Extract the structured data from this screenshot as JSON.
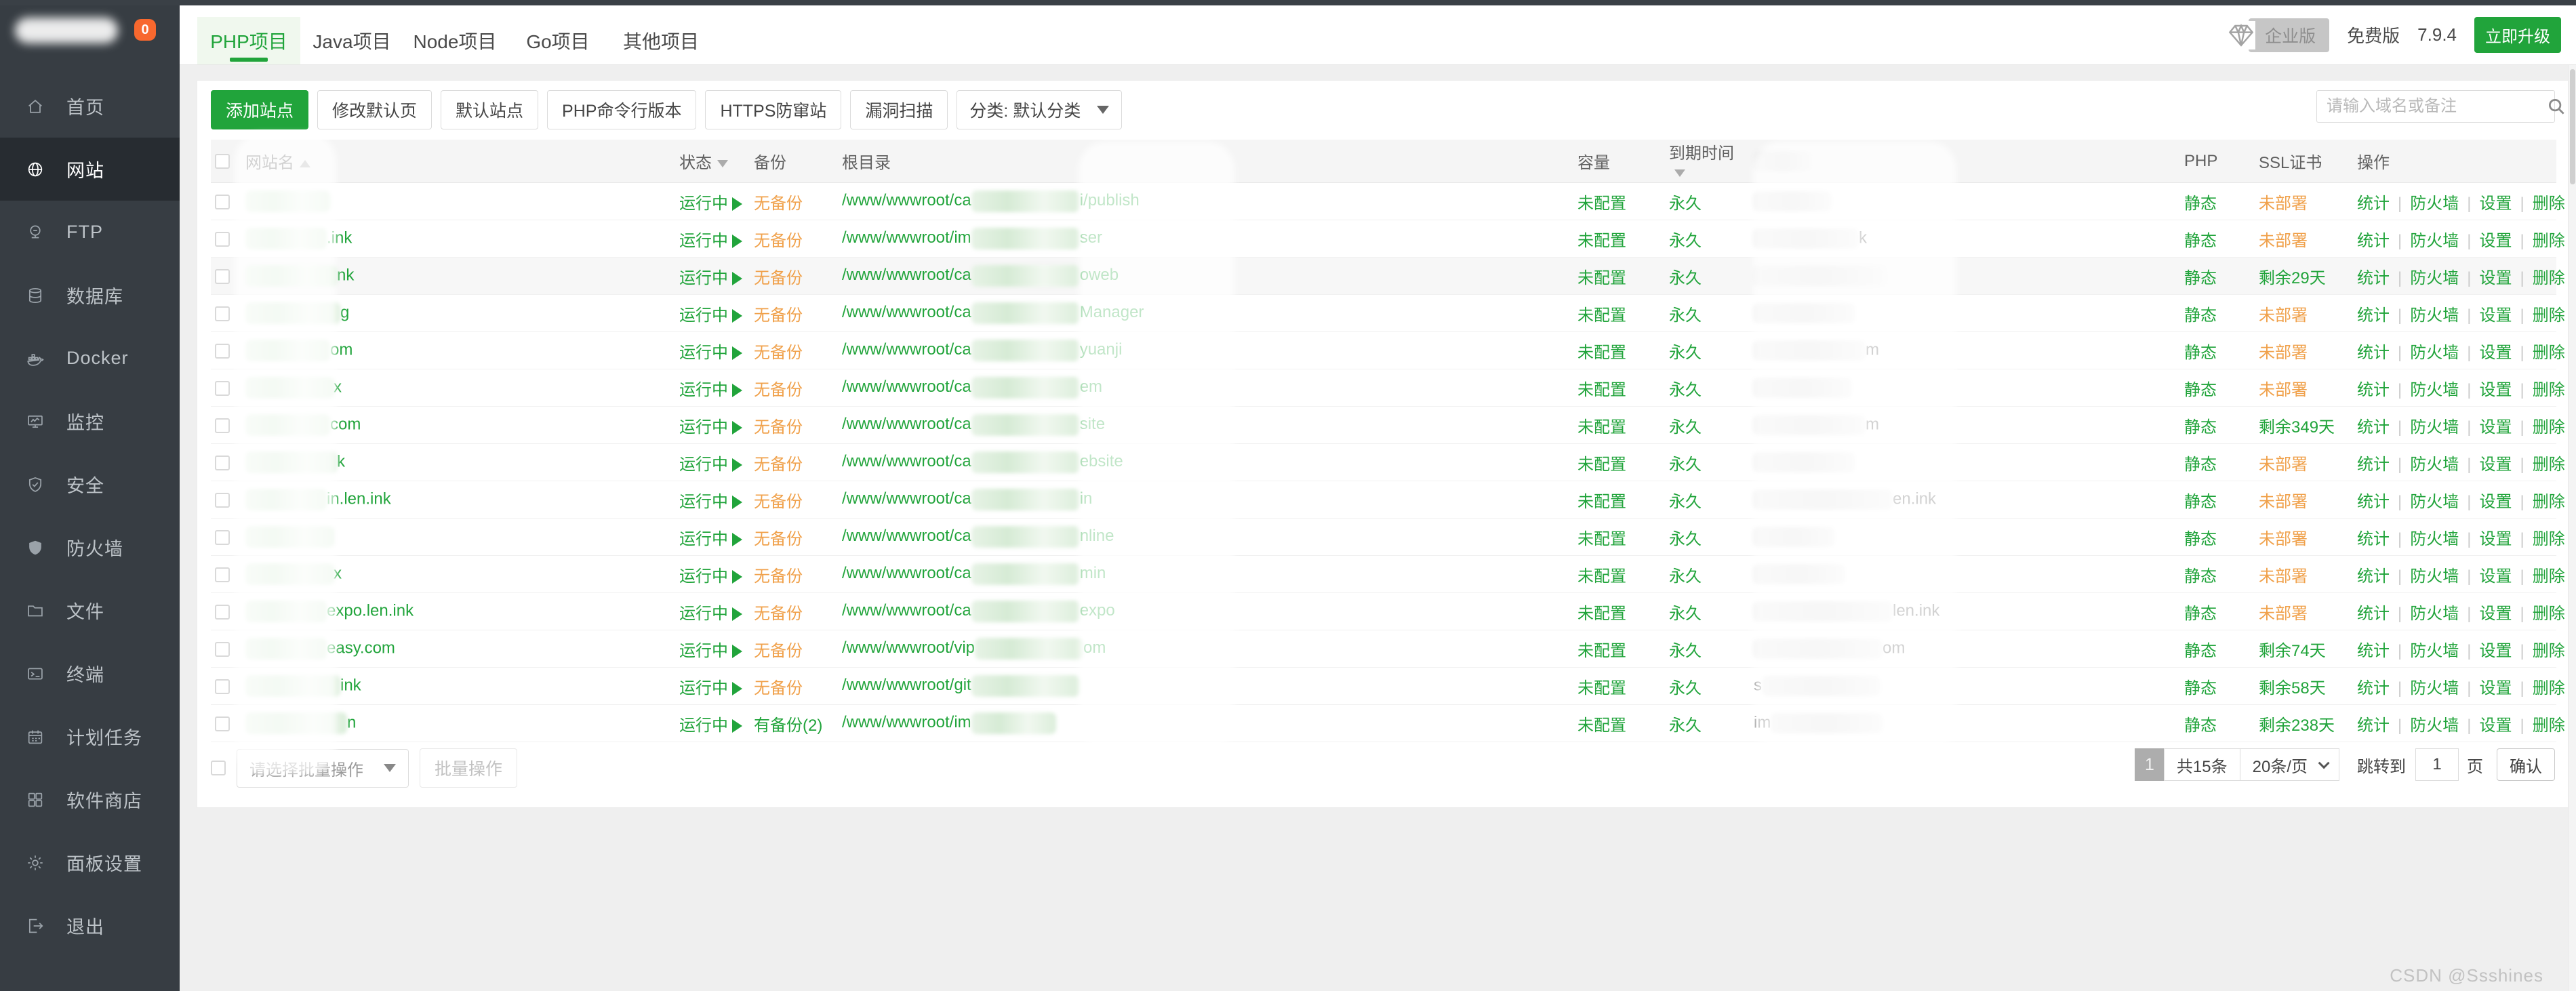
{
  "colors": {
    "green": "#21a43b",
    "orange": "#f0a14b",
    "sidebar-bg": "#373d43",
    "sidebar-sel": "#272c31",
    "badge-orange": "#f8682e",
    "page-bg": "#efefef"
  },
  "sidebar": {
    "logo_badge": "0",
    "items": [
      {
        "label": "首页",
        "icon": "home-icon",
        "selected": false
      },
      {
        "label": "网站",
        "icon": "globe-icon",
        "selected": true
      },
      {
        "label": "FTP",
        "icon": "ftp-icon",
        "selected": false
      },
      {
        "label": "数据库",
        "icon": "database-icon",
        "selected": false
      },
      {
        "label": "Docker",
        "icon": "docker-icon",
        "selected": false
      },
      {
        "label": "监控",
        "icon": "monitor-icon",
        "selected": false
      },
      {
        "label": "安全",
        "icon": "shield-check-icon",
        "selected": false
      },
      {
        "label": "防火墙",
        "icon": "firewall-icon",
        "selected": false
      },
      {
        "label": "文件",
        "icon": "folder-icon",
        "selected": false
      },
      {
        "label": "终端",
        "icon": "terminal-icon",
        "selected": false
      },
      {
        "label": "计划任务",
        "icon": "calendar-icon",
        "selected": false
      },
      {
        "label": "软件商店",
        "icon": "store-icon",
        "selected": false
      },
      {
        "label": "面板设置",
        "icon": "gear-icon",
        "selected": false
      },
      {
        "label": "退出",
        "icon": "logout-icon",
        "selected": false
      }
    ]
  },
  "tabs": [
    {
      "label": "PHP项目",
      "selected": true
    },
    {
      "label": "Java项目",
      "selected": false
    },
    {
      "label": "Node项目",
      "selected": false
    },
    {
      "label": "Go项目",
      "selected": false
    },
    {
      "label": "其他项目",
      "selected": false
    }
  ],
  "topbar": {
    "edition_badge": "企业版",
    "plan": "免费版",
    "version": "7.9.4",
    "upgrade": "立即升级"
  },
  "toolbar": {
    "primary": "添加站点",
    "buttons": [
      "修改默认页",
      "默认站点",
      "PHP命令行版本",
      "HTTPS防窜站",
      "漏洞扫描"
    ],
    "category": "分类: 默认分类",
    "search_placeholder": "请输入域名或备注"
  },
  "table": {
    "headers": {
      "site": "网站名",
      "status": "状态",
      "backup": "备份",
      "path": "根目录",
      "capacity": "容量",
      "expire": "到期时间",
      "note": "",
      "php": "PHP",
      "ssl": "SSL证书",
      "actions": "操作"
    },
    "status_label": "运行中",
    "capacity_label": "未配置",
    "expire_label": "永久",
    "php_label": "静态",
    "row_actions": [
      "统计",
      "防火墙",
      "设置",
      "删除"
    ],
    "rows": [
      {
        "name_sfx": "",
        "name_blur": 125,
        "backup": "无备份",
        "backup_ok": false,
        "path_pre": "/www/wwwroot/ca",
        "path_blur": 160,
        "path_sfx": "i/publish",
        "note_pre": "",
        "note_blur": 115,
        "note_sfx": "",
        "ssl": "未部署",
        "ssl_ok": false,
        "hover": false
      },
      {
        "name_sfx": ".ink",
        "name_blur": 120,
        "backup": "无备份",
        "backup_ok": false,
        "path_pre": "/www/wwwroot/im",
        "path_blur": 160,
        "path_sfx": "ser",
        "note_pre": "",
        "note_blur": 155,
        "note_sfx": "k",
        "ssl": "未部署",
        "ssl_ok": false,
        "hover": false
      },
      {
        "name_sfx": "nk",
        "name_blur": 135,
        "backup": "无备份",
        "backup_ok": false,
        "path_pre": "/www/wwwroot/ca",
        "path_blur": 160,
        "path_sfx": "oweb",
        "note_pre": "",
        "note_blur": 195,
        "note_sfx": "",
        "ssl": "剩余29天",
        "ssl_ok": true,
        "hover": true
      },
      {
        "name_sfx": "g",
        "name_blur": 140,
        "backup": "无备份",
        "backup_ok": false,
        "path_pre": "/www/wwwroot/ca",
        "path_blur": 160,
        "path_sfx": "Manager",
        "note_pre": "",
        "note_blur": 150,
        "note_sfx": "",
        "ssl": "未部署",
        "ssl_ok": false,
        "hover": false
      },
      {
        "name_sfx": "om",
        "name_blur": 125,
        "backup": "无备份",
        "backup_ok": false,
        "path_pre": "/www/wwwroot/ca",
        "path_blur": 160,
        "path_sfx": "yuanji",
        "note_pre": "",
        "note_blur": 165,
        "note_sfx": "m",
        "ssl": "未部署",
        "ssl_ok": false,
        "hover": false
      },
      {
        "name_sfx": "x",
        "name_blur": 130,
        "backup": "无备份",
        "backup_ok": false,
        "path_pre": "/www/wwwroot/ca",
        "path_blur": 160,
        "path_sfx": "em",
        "note_pre": "",
        "note_blur": 145,
        "note_sfx": "",
        "ssl": "未部署",
        "ssl_ok": false,
        "hover": false
      },
      {
        "name_sfx": "com",
        "name_blur": 125,
        "backup": "无备份",
        "backup_ok": false,
        "path_pre": "/www/wwwroot/ca",
        "path_blur": 160,
        "path_sfx": "site",
        "note_pre": "",
        "note_blur": 165,
        "note_sfx": "m",
        "ssl": "剩余349天",
        "ssl_ok": true,
        "hover": false
      },
      {
        "name_sfx": "k",
        "name_blur": 135,
        "backup": "无备份",
        "backup_ok": false,
        "path_pre": "/www/wwwroot/ca",
        "path_blur": 160,
        "path_sfx": "ebsite",
        "note_pre": "",
        "note_blur": 150,
        "note_sfx": "",
        "ssl": "未部署",
        "ssl_ok": false,
        "hover": false
      },
      {
        "name_sfx": "in.len.ink",
        "name_blur": 120,
        "backup": "无备份",
        "backup_ok": false,
        "path_pre": "/www/wwwroot/ca",
        "path_blur": 160,
        "path_sfx": "in",
        "note_pre": "",
        "note_blur": 205,
        "note_sfx": "en.ink",
        "ssl": "未部署",
        "ssl_ok": false,
        "hover": false
      },
      {
        "name_sfx": "",
        "name_blur": 130,
        "backup": "无备份",
        "backup_ok": false,
        "path_pre": "/www/wwwroot/ca",
        "path_blur": 160,
        "path_sfx": "nline",
        "note_pre": "",
        "note_blur": 120,
        "note_sfx": "",
        "ssl": "未部署",
        "ssl_ok": false,
        "hover": false
      },
      {
        "name_sfx": "x",
        "name_blur": 130,
        "backup": "无备份",
        "backup_ok": false,
        "path_pre": "/www/wwwroot/ca",
        "path_blur": 160,
        "path_sfx": "min",
        "note_pre": "",
        "note_blur": 135,
        "note_sfx": "",
        "ssl": "未部署",
        "ssl_ok": false,
        "hover": false
      },
      {
        "name_sfx": "expo.len.ink",
        "name_blur": 120,
        "backup": "无备份",
        "backup_ok": false,
        "path_pre": "/www/wwwroot/ca",
        "path_blur": 160,
        "path_sfx": "expo",
        "note_pre": "",
        "note_blur": 205,
        "note_sfx": "len.ink",
        "ssl": "未部署",
        "ssl_ok": false,
        "hover": false
      },
      {
        "name_sfx": "easy.com",
        "name_blur": 120,
        "backup": "无备份",
        "backup_ok": false,
        "path_pre": "/www/wwwroot/vip",
        "path_blur": 160,
        "path_sfx": "om",
        "note_pre": "",
        "note_blur": 190,
        "note_sfx": "om",
        "ssl": "剩余74天",
        "ssl_ok": true,
        "hover": false
      },
      {
        "name_sfx": "ink",
        "name_blur": 140,
        "backup": "无备份",
        "backup_ok": false,
        "path_pre": "/www/wwwroot/git",
        "path_blur": 160,
        "path_sfx": "",
        "note_pre": "s",
        "note_blur": 175,
        "note_sfx": "",
        "ssl": "剩余58天",
        "ssl_ok": true,
        "hover": false
      },
      {
        "name_sfx": "n",
        "name_blur": 150,
        "backup": "有备份(2)",
        "backup_ok": true,
        "path_pre": "/www/wwwroot/im",
        "path_blur": 125,
        "path_sfx": "",
        "note_pre": "im",
        "note_blur": 165,
        "note_sfx": "",
        "ssl": "剩余238天",
        "ssl_ok": true,
        "hover": false
      }
    ]
  },
  "batch": {
    "select_label": "请选择批量操作",
    "button": "批量操作"
  },
  "pagination": {
    "page": "1",
    "total": "共15条",
    "page_size": "20条/页",
    "jump_label": "跳转到",
    "jump_value": "1",
    "page_unit": "页",
    "confirm": "确认"
  },
  "watermark": "CSDN @Ssshines"
}
